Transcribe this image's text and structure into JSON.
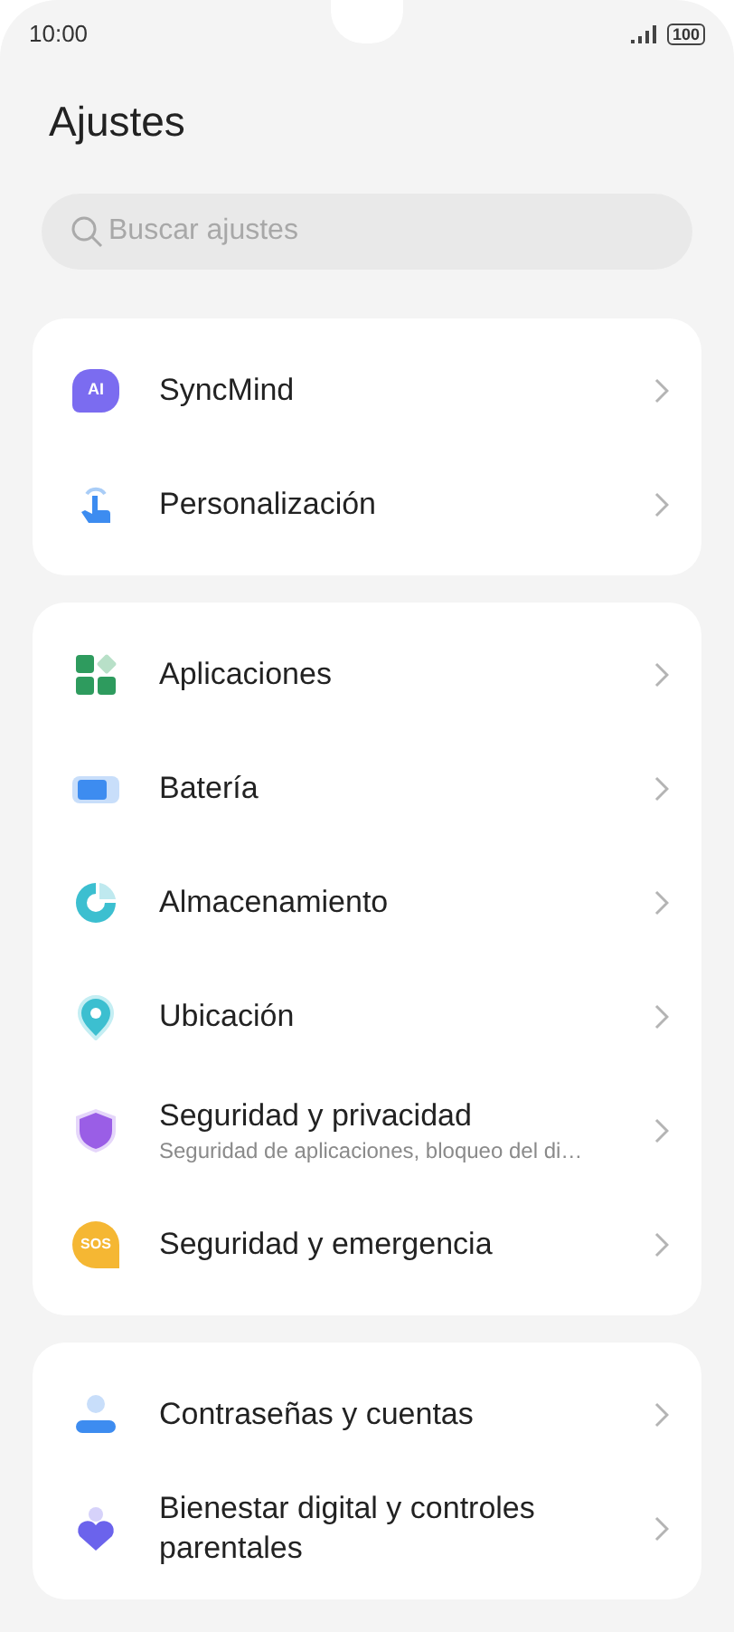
{
  "status_bar": {
    "time": "10:00",
    "battery": "100"
  },
  "title": "Ajustes",
  "search": {
    "placeholder": "Buscar ajustes"
  },
  "groups": [
    {
      "items": [
        {
          "kind": "ai",
          "icon_text": "AI",
          "label": "SyncMind"
        },
        {
          "kind": "touch",
          "label": "Personalización"
        }
      ]
    },
    {
      "items": [
        {
          "kind": "apps",
          "label": "Aplicaciones"
        },
        {
          "kind": "battery",
          "label": "Batería"
        },
        {
          "kind": "storage",
          "label": "Almacenamiento"
        },
        {
          "kind": "location",
          "label": "Ubicación"
        },
        {
          "kind": "shield",
          "label": "Seguridad y privacidad",
          "subtitle": "Seguridad de aplicaciones, bloqueo del di…"
        },
        {
          "kind": "sos",
          "icon_text": "SOS",
          "label": "Seguridad y emergencia"
        }
      ]
    },
    {
      "items": [
        {
          "kind": "person",
          "label": "Contraseñas y cuentas"
        },
        {
          "kind": "heart",
          "label": "Bienestar digital y controles parentales"
        }
      ]
    }
  ]
}
